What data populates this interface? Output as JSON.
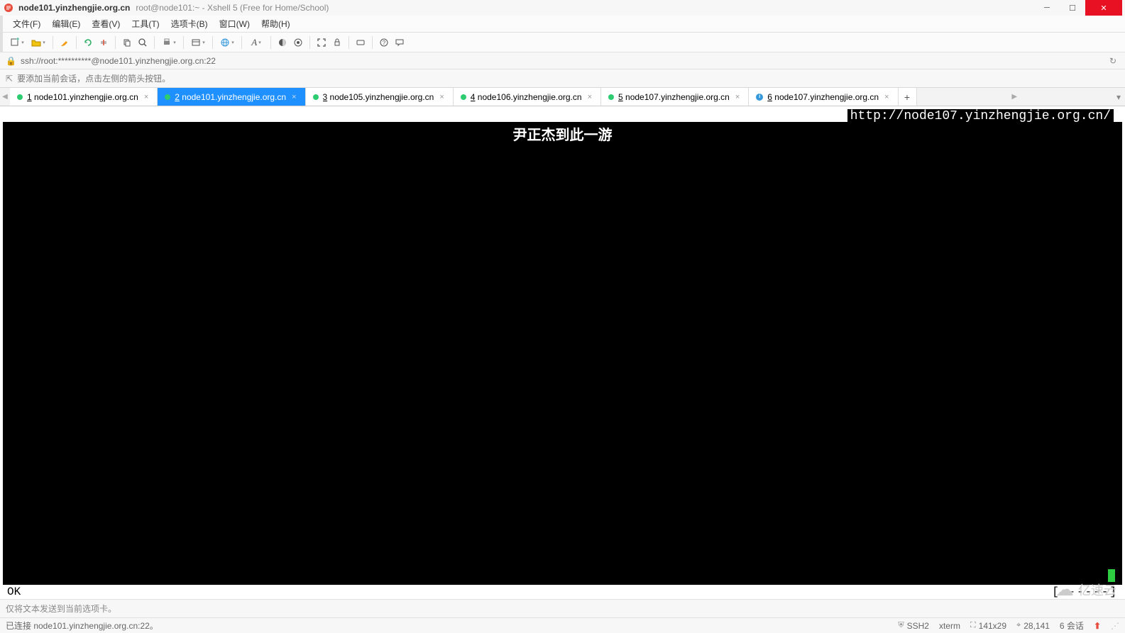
{
  "title": {
    "main": "node101.yinzhengjie.org.cn",
    "sub": "root@node101:~ - Xshell 5 (Free for Home/School)"
  },
  "menu": {
    "file": "文件(F)",
    "edit": "编辑(E)",
    "view": "查看(V)",
    "tools": "工具(T)",
    "tab": "选项卡(B)",
    "window": "窗口(W)",
    "help": "帮助(H)"
  },
  "address": {
    "url": "ssh://root:**********@node101.yinzhengjie.org.cn:22"
  },
  "hint": {
    "text": "要添加当前会话，点击左侧的箭头按钮。"
  },
  "tabs": [
    {
      "num": "1",
      "label": "node101.yinzhengjie.org.cn",
      "status": "green",
      "active": false
    },
    {
      "num": "2",
      "label": "node101.yinzhengjie.org.cn",
      "status": "green",
      "active": true
    },
    {
      "num": "3",
      "label": "node105.yinzhengjie.org.cn",
      "status": "green",
      "active": false
    },
    {
      "num": "4",
      "label": "node106.yinzhengjie.org.cn",
      "status": "green",
      "active": false
    },
    {
      "num": "5",
      "label": "node107.yinzhengjie.org.cn",
      "status": "green",
      "active": false
    },
    {
      "num": "6",
      "label": "node107.yinzhengjie.org.cn",
      "status": "info",
      "active": false
    }
  ],
  "terminal": {
    "url": "http://node107.yinzhengjie.org.cn/",
    "banner": "尹正杰到此一游",
    "ok": "OK",
    "dashes": "[------]"
  },
  "sendbar": {
    "text": "仅将文本发送到当前选项卡。"
  },
  "status": {
    "conn": "已连接 node101.yinzhengjie.org.cn:22。",
    "proto": "SSH2",
    "term": "xterm",
    "size": "141x29",
    "pos": "28,141",
    "sessions": "6 会话"
  },
  "watermark": {
    "text": "亿速云"
  }
}
